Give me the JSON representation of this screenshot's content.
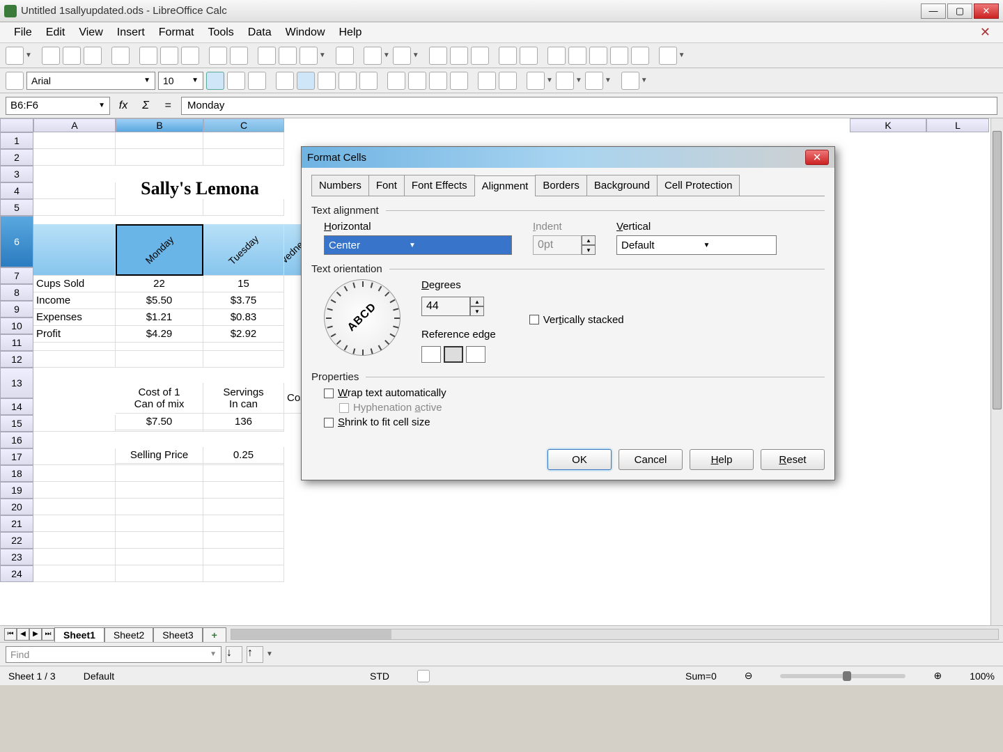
{
  "window": {
    "title": "Untitled 1sallyupdated.ods - LibreOffice Calc"
  },
  "menus": [
    "File",
    "Edit",
    "View",
    "Insert",
    "Format",
    "Tools",
    "Data",
    "Window",
    "Help"
  ],
  "font": {
    "name": "Arial",
    "size": "10"
  },
  "cellref": "B6:F6",
  "formula": "Monday",
  "columns": [
    "A",
    "B",
    "C"
  ],
  "col_k": "K",
  "col_l": "L",
  "rows": [
    "1",
    "2",
    "3",
    "4",
    "5",
    "6",
    "7",
    "8",
    "9",
    "10",
    "11",
    "12",
    "13",
    "14",
    "15",
    "16",
    "17",
    "18",
    "19",
    "20",
    "21",
    "22",
    "23",
    "24"
  ],
  "sheet": {
    "title_text": "Sally's Lemona",
    "days": [
      "Monday",
      "Tuesday",
      "Wednesd"
    ],
    "data_rows": [
      {
        "label": "Cups Sold",
        "b": "22",
        "c": "15"
      },
      {
        "label": "Income",
        "b": "$5.50",
        "c": "$3.75"
      },
      {
        "label": "Expenses",
        "b": "$1.21",
        "c": "$0.83"
      },
      {
        "label": "Profit",
        "b": "$4.29",
        "c": "$2.92"
      }
    ],
    "cost_hdr_b": "Cost of 1\nCan of mix",
    "cost_hdr_c": "Servings\nIn can",
    "cost_hdr_d": "Cos",
    "cost_b": "$7.50",
    "cost_c": "136",
    "sell_label": "Selling Price",
    "sell_val": "0.25"
  },
  "tabs": [
    "Sheet1",
    "Sheet2",
    "Sheet3"
  ],
  "find_placeholder": "Find",
  "status": {
    "sheet": "Sheet 1 / 3",
    "style": "Default",
    "mode": "STD",
    "sum": "Sum=0",
    "zoom": "100%"
  },
  "dialog": {
    "title": "Format Cells",
    "tabs": [
      "Numbers",
      "Font",
      "Font Effects",
      "Alignment",
      "Borders",
      "Background",
      "Cell Protection"
    ],
    "active_tab": "Alignment",
    "text_alignment_label": "Text alignment",
    "horizontal_label": "Horizontal",
    "horizontal_value": "Center",
    "indent_label": "Indent",
    "indent_value": "0pt",
    "vertical_label": "Vertical",
    "vertical_value": "Default",
    "text_orientation_label": "Text orientation",
    "degrees_label": "Degrees",
    "degrees_value": "44",
    "ref_edge_label": "Reference edge",
    "vert_stacked_label": "Vertically stacked",
    "dial_text": "ABCD",
    "properties_label": "Properties",
    "wrap_label": "Wrap text automatically",
    "hyph_label": "Hyphenation active",
    "shrink_label": "Shrink to fit cell size",
    "ok": "OK",
    "cancel": "Cancel",
    "help": "Help",
    "reset": "Reset"
  }
}
